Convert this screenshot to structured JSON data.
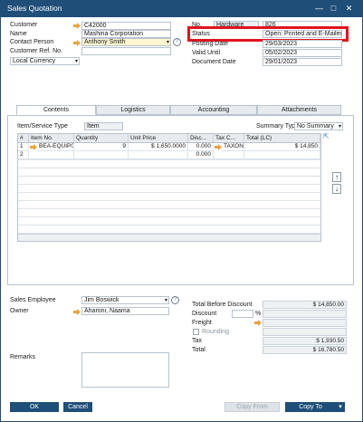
{
  "window": {
    "title": "Sales Quotation",
    "minimize": "—",
    "maximize": "□",
    "close": "✕"
  },
  "header_left": {
    "customer_label": "Customer",
    "customer_value": "C42000",
    "name_label": "Name",
    "name_value": "Mashina Corporation",
    "contact_label": "Contact Person",
    "contact_value": "Anthony Smith",
    "ref_label": "Customer Ref. No.",
    "ref_value": "",
    "currency_value": "Local Currency"
  },
  "header_right": {
    "no_label": "No.",
    "series_value": "Hardware",
    "no_value": "826",
    "status_label": "Status",
    "status_value": "Open: Printed and E-Mailed",
    "posting_label": "Posting Date",
    "posting_value": "29/03/2023",
    "valid_label": "Valid Until",
    "valid_value": "05/02/2023",
    "docdate_label": "Document Date",
    "docdate_value": "29/01/2023"
  },
  "tabs": [
    {
      "label": "Contents",
      "active": true
    },
    {
      "label": "Logistics",
      "active": false
    },
    {
      "label": "Accounting",
      "active": false
    },
    {
      "label": "Attachments",
      "active": false
    }
  ],
  "contents": {
    "service_type_label": "Item/Service Type",
    "service_type_value": "Item",
    "summary_label": "Summary Type",
    "summary_value": "No Summary",
    "columns": [
      "#",
      "Item No.",
      "Quantity",
      "Unit Price",
      "Disc...",
      "Tax C...",
      "Total (LC)"
    ],
    "rows": [
      {
        "num": "1",
        "item": "BEA-EQUIP002",
        "qty": "9",
        "price": "$ 1,650.0000",
        "disc": "0.000",
        "tax": "TAXON",
        "total": "$ 14,850"
      },
      {
        "num": "2",
        "item": "",
        "qty": "",
        "price": "",
        "disc": "0.000",
        "tax": "",
        "total": ""
      }
    ]
  },
  "footer_left": {
    "employee_label": "Sales Employee",
    "employee_value": "Jim Boswick",
    "owner_label": "Owner",
    "owner_value": "Aharoni, Naama",
    "remarks_label": "Remarks"
  },
  "totals": {
    "before_discount_label": "Total Before Discount",
    "before_discount_value": "$ 14,850.00",
    "discount_label": "Discount",
    "discount_pct_sign": "%",
    "freight_label": "Freight",
    "rounding_label": "Rounding",
    "tax_label": "Tax",
    "tax_value": "$ 1,930.50",
    "total_label": "Total",
    "total_value": "$ 16,780.50"
  },
  "buttons": {
    "ok": "OK",
    "cancel": "Cancel",
    "copy_from": "Copy From",
    "copy_to": "Copy To"
  },
  "colors": {
    "titlebar": "#1f4e79",
    "highlight": "#e0141e",
    "link_arrow": "#e8a33d"
  }
}
